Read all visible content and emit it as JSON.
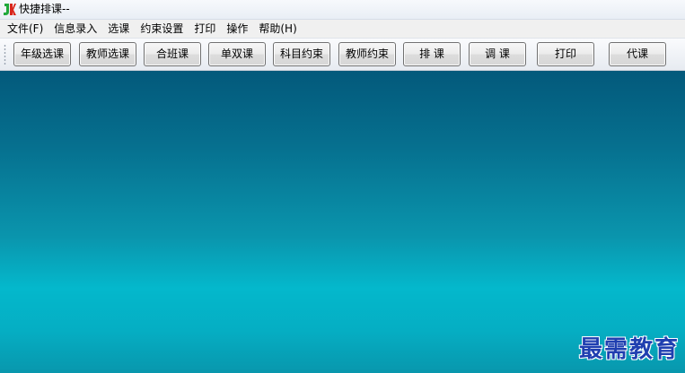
{
  "window": {
    "title": "快捷排课--"
  },
  "menu": {
    "items": [
      "文件(F)",
      "信息录入",
      "选课",
      "约束设置",
      "打印",
      "操作",
      "帮助(H)"
    ]
  },
  "toolbar": {
    "buttons": [
      "年级选课",
      "教师选课",
      "合班课",
      "单双课",
      "科目约束",
      "教师约束",
      "排 课",
      "调 课",
      "打印",
      "代课"
    ]
  },
  "workspace": {
    "watermark": "最需教育"
  },
  "colors": {
    "workspace_top": "#03597b",
    "workspace_mid": "#04b8cc",
    "watermark": "#1f3fb0",
    "icon_green": "#1fa83a",
    "icon_red": "#d9261c"
  },
  "icons": {
    "app": "app-logo-icon",
    "grip": "toolbar-grip-icon"
  }
}
